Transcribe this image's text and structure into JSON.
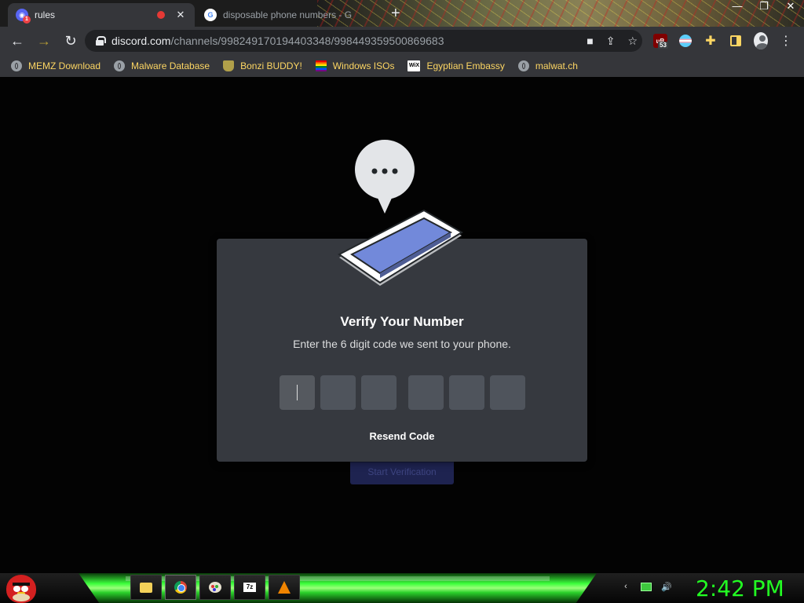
{
  "browser": {
    "tabs": [
      {
        "title": "rules",
        "active": true
      },
      {
        "title": "disposable phone numbers - G",
        "active": false
      }
    ],
    "newtab_label": "+",
    "url": {
      "host": "discord.com",
      "path": "/channels/998249170194403348/998449359500869683"
    },
    "ublock_badge": "53",
    "bookmarks": [
      {
        "label": "MEMZ Download",
        "icon": "globe-icon"
      },
      {
        "label": "Malware Database",
        "icon": "globe-icon"
      },
      {
        "label": "Bonzi BUDDY!",
        "icon": "bonzi-icon"
      },
      {
        "label": "Windows ISOs",
        "icon": "rainbow-flag-icon"
      },
      {
        "label": "Egyptian Embassy",
        "icon": "wix-icon"
      },
      {
        "label": "malwat.ch",
        "icon": "globe-icon"
      }
    ],
    "colors": {
      "bookmark_text": "#fdd663",
      "chrome_bg": "#35363a"
    }
  },
  "modal": {
    "title": "Verify Your Number",
    "subtitle": "Enter the 6 digit code we sent to your phone.",
    "digits": [
      "",
      "",
      "",
      "",
      "",
      ""
    ],
    "resend_label": "Resend Code",
    "colors": {
      "modal_bg": "#36393f",
      "digit_bg": "#4f545c"
    }
  },
  "background_page": {
    "start_button": "Start Verification"
  },
  "taskbar": {
    "clock": "2:42 PM",
    "apps": [
      "folder-icon",
      "chrome-icon",
      "paint-icon",
      "7zip-icon",
      "vlc-icon"
    ],
    "colors": {
      "clock": "#22ff22",
      "glow": "#3cff3c"
    }
  }
}
